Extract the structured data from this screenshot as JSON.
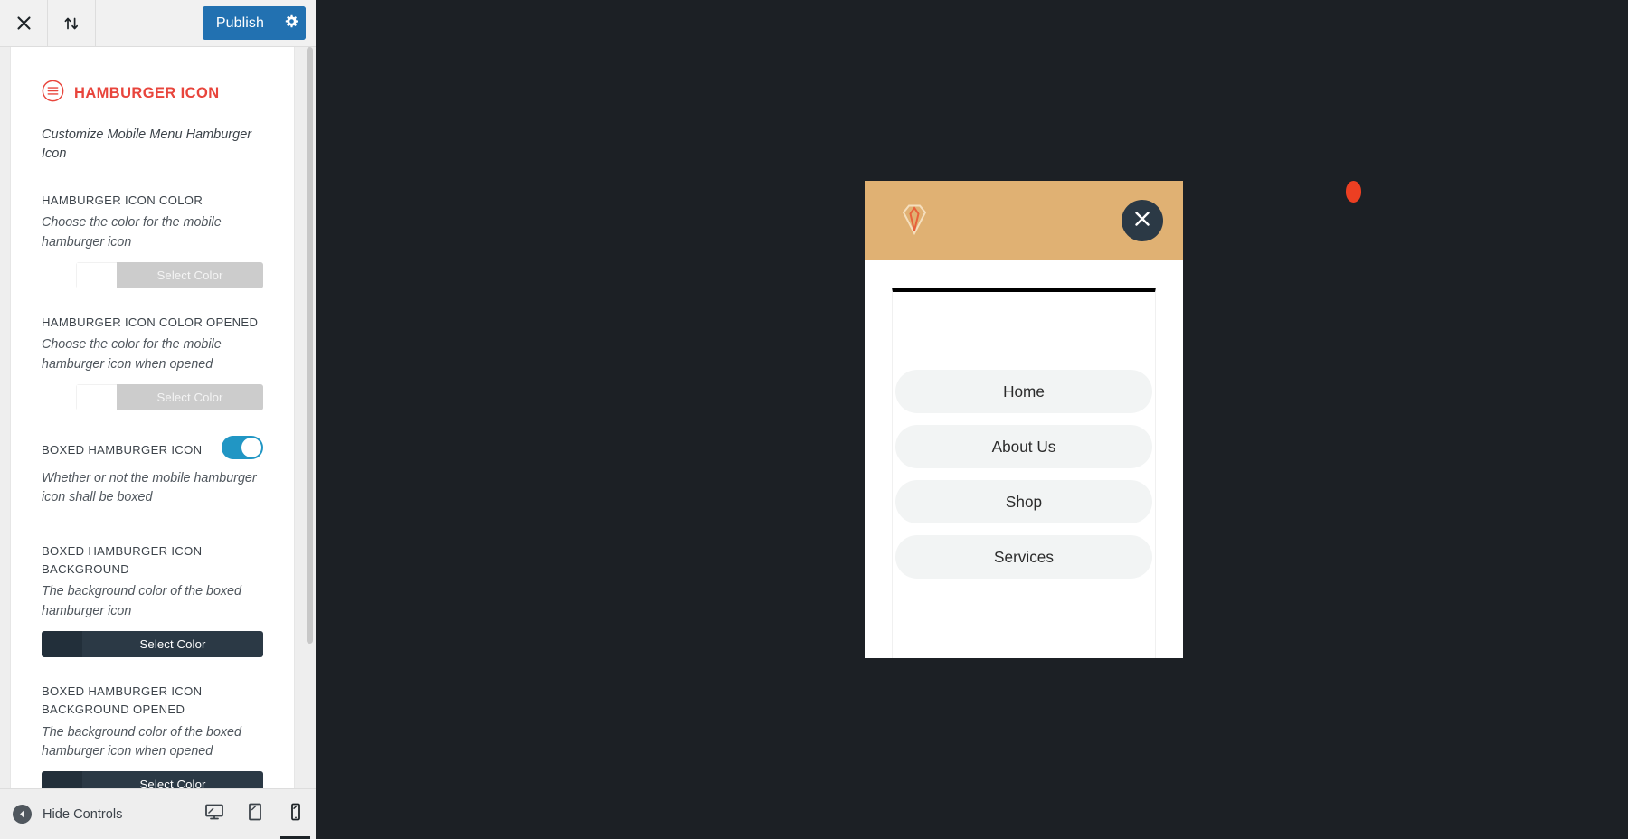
{
  "customizer": {
    "header": {
      "close_label": "close-customizer",
      "changeset_label": "reorder",
      "publish_label": "Publish",
      "settings_label": "publish-settings"
    },
    "section": {
      "icon": "hamburger-circle-icon",
      "title": "HAMBURGER ICON",
      "description": "Customize Mobile Menu Hamburger Icon",
      "accent_color": "#e8453c"
    },
    "fields": [
      {
        "label": "HAMBURGER ICON COLOR",
        "description": "Choose the color for the mobile hamburger icon",
        "control": "color",
        "button_label": "Select Color",
        "swatch_color": "#ffffff",
        "state": "disabled"
      },
      {
        "label": "HAMBURGER ICON COLOR OPENED",
        "description": "Choose the color for the mobile hamburger icon when opened",
        "control": "color",
        "button_label": "Select Color",
        "swatch_color": "#ffffff",
        "state": "disabled"
      },
      {
        "label": "BOXED HAMBURGER ICON",
        "description": "Whether or not the mobile hamburger icon shall be boxed",
        "control": "toggle",
        "value": "on",
        "toggle_color": "#2196c4"
      },
      {
        "label": "BOXED HAMBURGER ICON BACKGROUND",
        "description": "The background color of the boxed hamburger icon",
        "control": "color",
        "button_label": "Select Color",
        "swatch_color": "#222f3a",
        "state": "enabled"
      },
      {
        "label": "BOXED HAMBURGER ICON BACKGROUND OPENED",
        "description": "The background color of the boxed hamburger icon when opened",
        "control": "color",
        "button_label": "Select Color",
        "swatch_color": "#222f3a",
        "state": "enabled"
      }
    ],
    "footer": {
      "hide_controls_label": "Hide Controls",
      "devices": [
        {
          "name": "desktop",
          "active": false
        },
        {
          "name": "tablet",
          "active": false
        },
        {
          "name": "mobile",
          "active": true
        }
      ]
    }
  },
  "preview": {
    "header_background": "#e0b173",
    "logo_name": "gem-diamond-logo",
    "close_button_background": "#2b3945",
    "accent_dot_color": "#ec3f22",
    "menu_items": [
      {
        "label": "Home"
      },
      {
        "label": "About Us"
      },
      {
        "label": "Shop"
      },
      {
        "label": "Services"
      }
    ]
  }
}
